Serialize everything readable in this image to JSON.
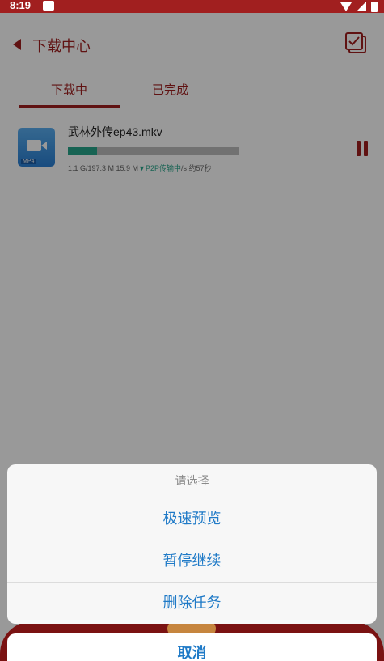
{
  "status_bar": {
    "time": "8:19"
  },
  "app_bar": {
    "title": "下载中心"
  },
  "tabs": [
    {
      "label": "下载中"
    },
    {
      "label": "已完成"
    }
  ],
  "download": {
    "file_name": "武林外传ep43.mkv",
    "badge": "MP4",
    "progress": 0.17,
    "stats_size": "1.1 G/197.3 M 15.9 M",
    "stats_p2p": "▼P2P传输中",
    "stats_rest": "/s 约57秒"
  },
  "action_sheet": {
    "title": "请选择",
    "options": [
      {
        "label": "极速预览"
      },
      {
        "label": "暂停继续"
      },
      {
        "label": "删除任务"
      }
    ],
    "cancel": "取消"
  },
  "colors": {
    "primary": "#a11f1f",
    "progress": "#27a58a",
    "sheet_text": "#1f7ac7"
  }
}
